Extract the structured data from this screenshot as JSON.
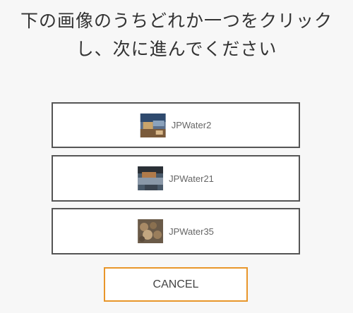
{
  "dialog": {
    "title_line1": "下の画像のうちどれか一つをクリック",
    "title_line2": "し、次に進んでください"
  },
  "choices": [
    {
      "label": "JPWater2",
      "thumbnail": "photo-icon"
    },
    {
      "label": "JPWater21",
      "thumbnail": "photo-icon"
    },
    {
      "label": "JPWater35",
      "thumbnail": "photo-icon"
    }
  ],
  "cancel_label": "CANCEL",
  "colors": {
    "background": "#f7f7f7",
    "choice_border": "#555555",
    "cancel_border": "#e8962a",
    "title_text": "#333333",
    "label_text": "#666666"
  }
}
